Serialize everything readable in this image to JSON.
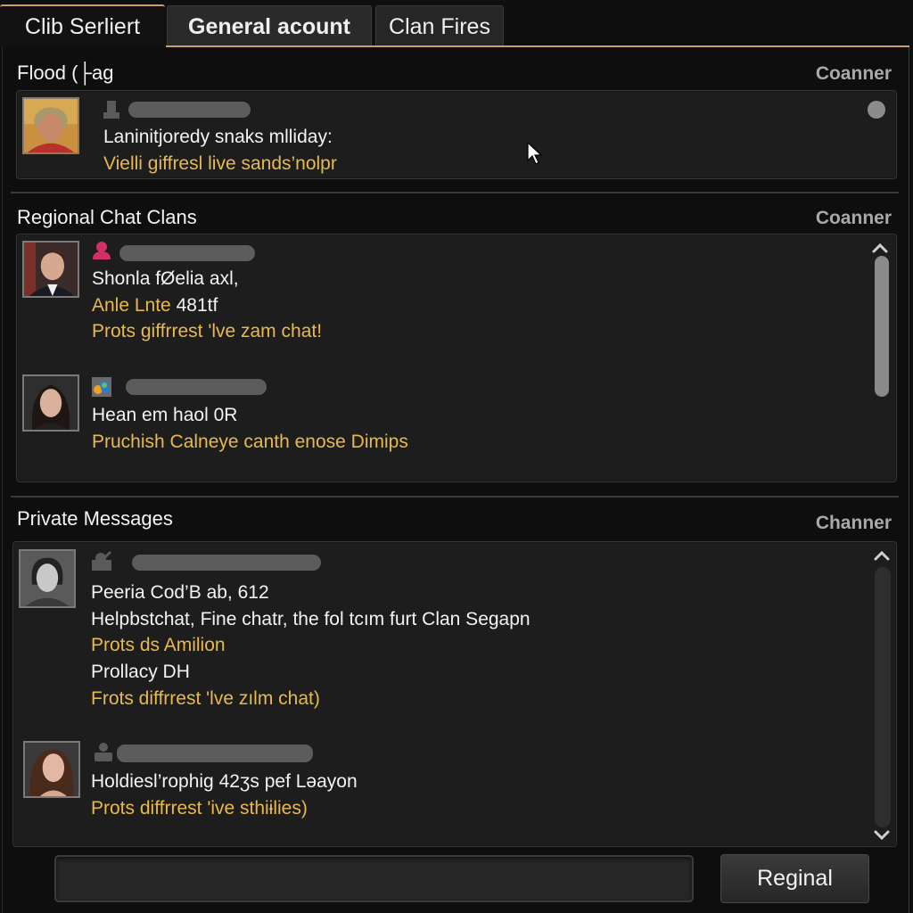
{
  "tabs": [
    {
      "label": "Clib Serliert",
      "active": false
    },
    {
      "label": "General acount",
      "active": true
    },
    {
      "label": "Clan Fires",
      "active": false
    }
  ],
  "colors": {
    "accent": "#c9a06a",
    "gold_text": "#e8b94c",
    "background": "#0e0e0e",
    "panel": "#1d1d1d"
  },
  "sections": {
    "flood": {
      "title": "Flood (├ag",
      "meta": "Coanner",
      "messages": [
        {
          "role_icon": "user-silhouette-icon",
          "lines": [
            {
              "text": "Laninitjoredy snaks mlliday:",
              "style": "white"
            },
            {
              "text": "Vielli giffresl live sands’nolpr",
              "style": "gold"
            }
          ]
        }
      ]
    },
    "regional": {
      "title": "Regional Chat Clans",
      "meta": "Coanner",
      "messages": [
        {
          "role_icon": "moderator-user-icon",
          "lines": [
            {
              "text": "Shonla fØelia axl,",
              "style": "white"
            },
            {
              "text": "Anle Lnte",
              "style": "gold",
              "suffix": " 481tf"
            },
            {
              "text": "Prots giffrrest 'lve zam chat!",
              "style": "gold"
            }
          ]
        },
        {
          "role_icon": "game-badge-icon",
          "lines": [
            {
              "text": "Hean em haol 0R",
              "style": "white"
            },
            {
              "text": "Pruchish Calneye canth enose Dimips",
              "style": "gold"
            }
          ]
        }
      ]
    },
    "private": {
      "title": "Private Messages",
      "meta": "Channer",
      "messages": [
        {
          "role_icon": "user-edit-icon",
          "lines": [
            {
              "text": "Peeria Cod’B ab, 612",
              "style": "white"
            },
            {
              "text": "Helpbstchat, Fine chatr, the fol tcım furt Clan Segapn",
              "style": "white"
            },
            {
              "text": "Prots ds Amilion",
              "style": "gold"
            },
            {
              "text": "Prollacy DH",
              "style": "white"
            },
            {
              "text": "Frots diffrrest 'lve zılm chat)",
              "style": "gold"
            }
          ]
        },
        {
          "role_icon": "user-silhouette-icon",
          "lines": [
            {
              "text": "Holdiesl’rophig 42ʒs pef Ləayon",
              "style": "white"
            },
            {
              "text": "Prots diffrrest 'ive sthiɨlies)",
              "style": "gold"
            }
          ]
        }
      ]
    }
  },
  "composer": {
    "input_value": "",
    "input_placeholder": "",
    "send_label": "Reginal"
  }
}
